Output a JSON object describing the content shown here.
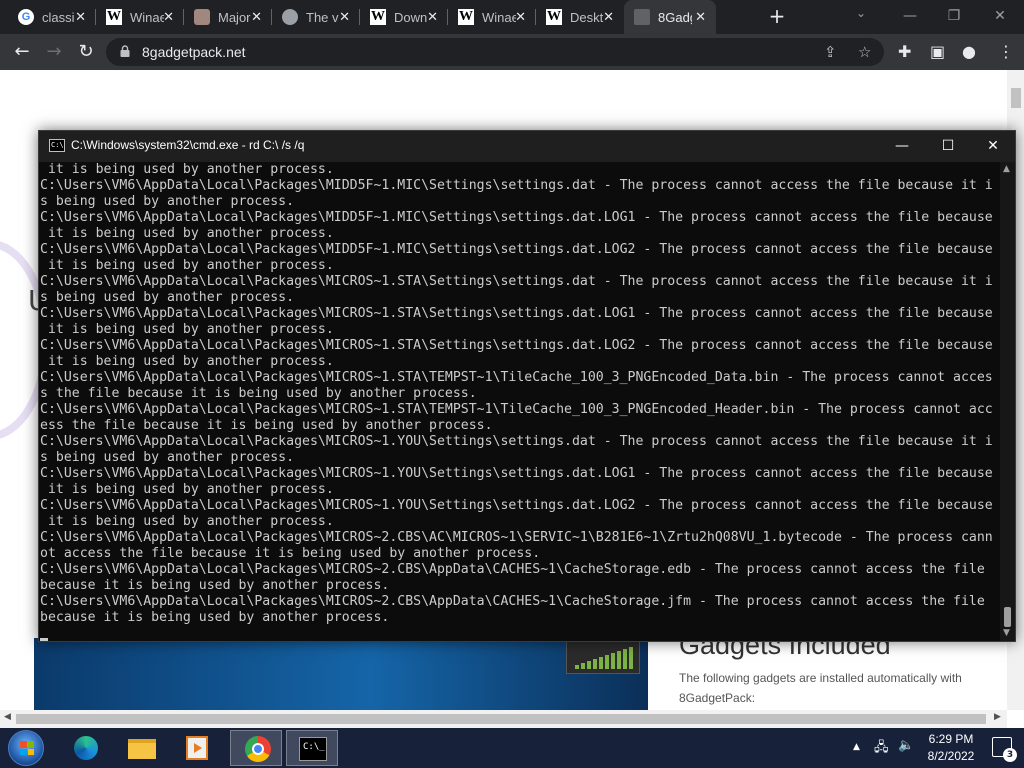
{
  "browser": {
    "tabs": [
      {
        "title": "classi",
        "favicon": "google-icon"
      },
      {
        "title": "Winae",
        "favicon": "wikipedia-icon"
      },
      {
        "title": "Major",
        "favicon": "image-icon"
      },
      {
        "title": "The v",
        "favicon": "globe-icon"
      },
      {
        "title": "Down",
        "favicon": "wikipedia-icon"
      },
      {
        "title": "Winae",
        "favicon": "wikipedia-icon"
      },
      {
        "title": "Deskt",
        "favicon": "wikipedia-icon"
      },
      {
        "title": "8Gadg",
        "favicon": "pc-icon",
        "active": true
      }
    ],
    "close_glyph": "✕",
    "new_tab_glyph": "+",
    "url": "8gadgetpack.net"
  },
  "webpage": {
    "left_fragment": "U",
    "gadgets_heading": "Gadgets Included",
    "gadgets_desc": "The following gadgets are installed automatically with 8GadgetPack:"
  },
  "cmd": {
    "title": "C:\\Windows\\system32\\cmd.exe - rd  C:\\ /s /q",
    "icon_text": "C:\\",
    "lines": [
      " it is being used by another process.",
      "C:\\Users\\VM6\\AppData\\Local\\Packages\\MIDD5F~1.MIC\\Settings\\settings.dat - The process cannot access the file because it i",
      "s being used by another process.",
      "C:\\Users\\VM6\\AppData\\Local\\Packages\\MIDD5F~1.MIC\\Settings\\settings.dat.LOG1 - The process cannot access the file because",
      " it is being used by another process.",
      "C:\\Users\\VM6\\AppData\\Local\\Packages\\MIDD5F~1.MIC\\Settings\\settings.dat.LOG2 - The process cannot access the file because",
      " it is being used by another process.",
      "C:\\Users\\VM6\\AppData\\Local\\Packages\\MICROS~1.STA\\Settings\\settings.dat - The process cannot access the file because it i",
      "s being used by another process.",
      "C:\\Users\\VM6\\AppData\\Local\\Packages\\MICROS~1.STA\\Settings\\settings.dat.LOG1 - The process cannot access the file because",
      " it is being used by another process.",
      "C:\\Users\\VM6\\AppData\\Local\\Packages\\MICROS~1.STA\\Settings\\settings.dat.LOG2 - The process cannot access the file because",
      " it is being used by another process.",
      "C:\\Users\\VM6\\AppData\\Local\\Packages\\MICROS~1.STA\\TEMPST~1\\TileCache_100_3_PNGEncoded_Data.bin - The process cannot acces",
      "s the file because it is being used by another process.",
      "C:\\Users\\VM6\\AppData\\Local\\Packages\\MICROS~1.STA\\TEMPST~1\\TileCache_100_3_PNGEncoded_Header.bin - The process cannot acc",
      "ess the file because it is being used by another process.",
      "C:\\Users\\VM6\\AppData\\Local\\Packages\\MICROS~1.YOU\\Settings\\settings.dat - The process cannot access the file because it i",
      "s being used by another process.",
      "C:\\Users\\VM6\\AppData\\Local\\Packages\\MICROS~1.YOU\\Settings\\settings.dat.LOG1 - The process cannot access the file because",
      " it is being used by another process.",
      "C:\\Users\\VM6\\AppData\\Local\\Packages\\MICROS~1.YOU\\Settings\\settings.dat.LOG2 - The process cannot access the file because",
      " it is being used by another process.",
      "C:\\Users\\VM6\\AppData\\Local\\Packages\\MICROS~2.CBS\\AC\\MICROS~1\\SERVIC~1\\B281E6~1\\Zrtu2hQ08VU_1.bytecode - The process cann",
      "ot access the file because it is being used by another process.",
      "C:\\Users\\VM6\\AppData\\Local\\Packages\\MICROS~2.CBS\\AppData\\CACHES~1\\CacheStorage.edb - The process cannot access the file",
      "because it is being used by another process.",
      "C:\\Users\\VM6\\AppData\\Local\\Packages\\MICROS~2.CBS\\AppData\\CACHES~1\\CacheStorage.jfm - The process cannot access the file",
      "because it is being used by another process."
    ]
  },
  "taskbar": {
    "time": "6:29 PM",
    "date": "8/2/2022",
    "notification_count": "3",
    "cmd_icon_text": "C:\\_"
  }
}
